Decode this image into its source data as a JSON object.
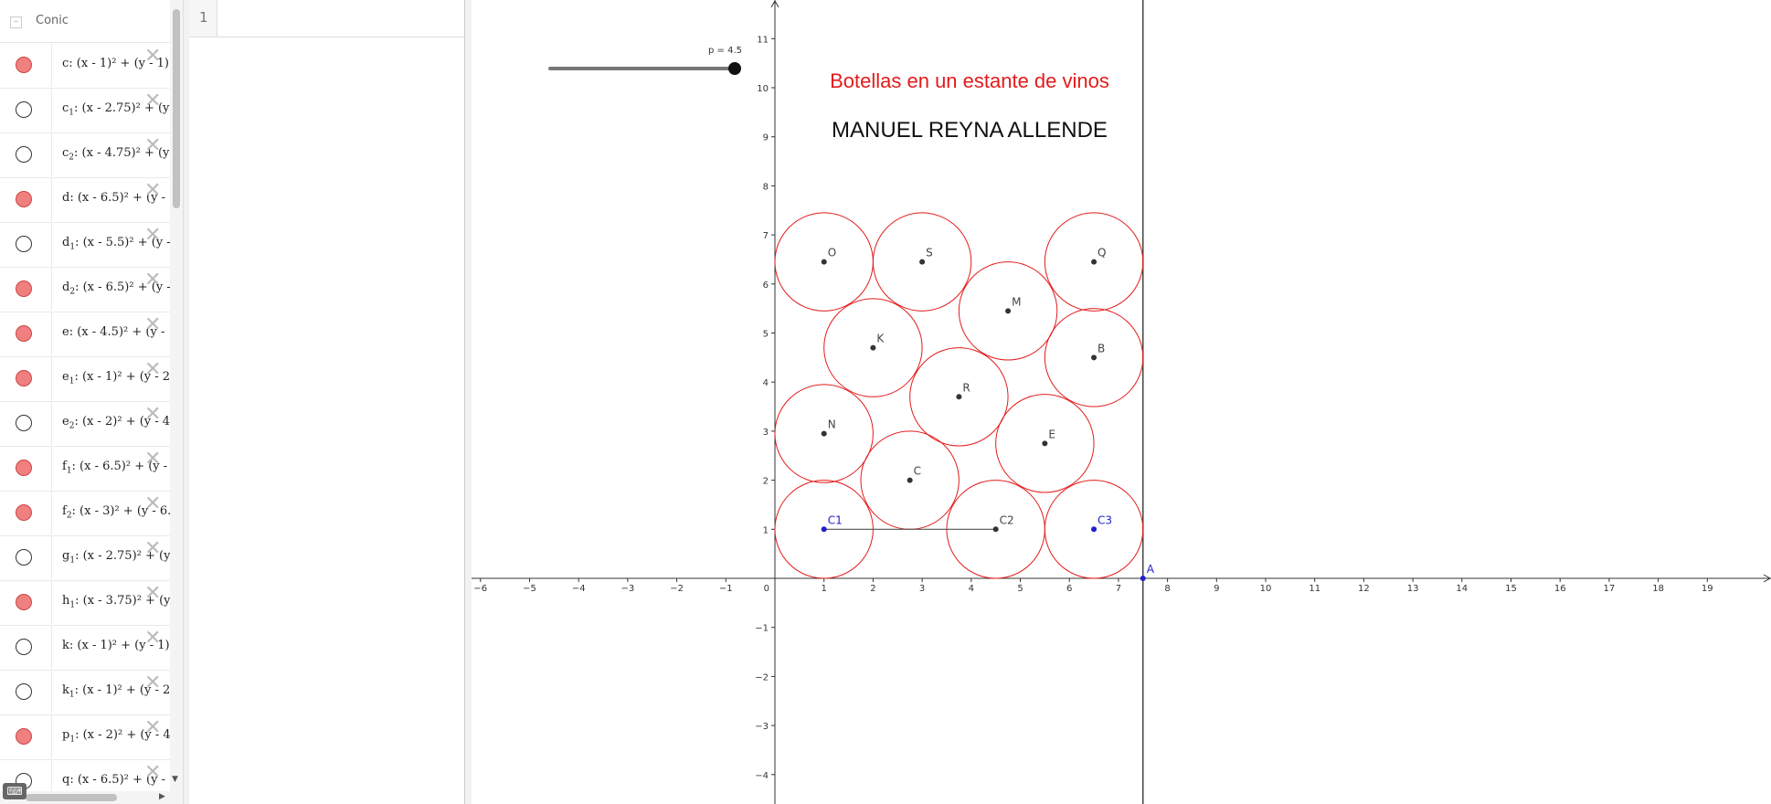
{
  "algebra": {
    "header": "Conic",
    "items": [
      {
        "name": "c",
        "sub": "",
        "expr": ": (x - 1)² + (y - 1)",
        "on": true
      },
      {
        "name": "c",
        "sub": "1",
        "expr": ": (x - 2.75)² + (y",
        "on": false
      },
      {
        "name": "c",
        "sub": "2",
        "expr": ": (x - 4.75)² + (y",
        "on": false
      },
      {
        "name": "d",
        "sub": "",
        "expr": ": (x - 6.5)² + (y -",
        "on": true
      },
      {
        "name": "d",
        "sub": "1",
        "expr": ": (x - 5.5)² + (y -",
        "on": false
      },
      {
        "name": "d",
        "sub": "2",
        "expr": ": (x - 6.5)² + (y -",
        "on": true
      },
      {
        "name": "e",
        "sub": "",
        "expr": ": (x - 4.5)² + (y - 1",
        "on": true
      },
      {
        "name": "e",
        "sub": "1",
        "expr": ": (x - 1)² + (y - 2",
        "on": true
      },
      {
        "name": "e",
        "sub": "2",
        "expr": ": (x - 2)² + (y - 4",
        "on": false
      },
      {
        "name": "f",
        "sub": "1",
        "expr": ": (x - 6.5)² + (y -",
        "on": true
      },
      {
        "name": "f",
        "sub": "2",
        "expr": ": (x - 3)² + (y - 6.",
        "on": true
      },
      {
        "name": "g",
        "sub": "1",
        "expr": ": (x - 2.75)² + (y",
        "on": false
      },
      {
        "name": "h",
        "sub": "1",
        "expr": ": (x - 3.75)² + (y",
        "on": true
      },
      {
        "name": "k",
        "sub": "",
        "expr": ": (x - 1)² + (y - 1)",
        "on": false
      },
      {
        "name": "k",
        "sub": "1",
        "expr": ": (x - 1)² + (y - 2",
        "on": false
      },
      {
        "name": "p",
        "sub": "1",
        "expr": ": (x - 2)² + (y - 4",
        "on": true
      },
      {
        "name": "q",
        "sub": "",
        "expr": ": (x - 6.5)² + (y -",
        "on": false
      }
    ]
  },
  "spreadsheet": {
    "row1": "1"
  },
  "graphics": {
    "title": "Botellas en un estante de vinos",
    "author": "MANUEL REYNA ALLENDE",
    "slider": {
      "label": "p = 4.5",
      "value": 4.5,
      "min": 0,
      "max": 4.5
    },
    "xticks": [
      -6,
      -5,
      -4,
      -3,
      -2,
      -1,
      1,
      2,
      3,
      4,
      5,
      6,
      7,
      8,
      9,
      10,
      11,
      12,
      13,
      14,
      15,
      16,
      17,
      18,
      19
    ],
    "yticks": [
      -4,
      -3,
      -2,
      -1,
      1,
      2,
      3,
      4,
      5,
      6,
      7,
      8,
      9,
      10,
      11
    ],
    "origin_label": "0",
    "wall_x": 7.5,
    "circles": [
      {
        "label": "C1",
        "x": 1,
        "y": 1,
        "blue": true
      },
      {
        "label": "C2",
        "x": 4.5,
        "y": 1,
        "blue": false
      },
      {
        "label": "C3",
        "x": 6.5,
        "y": 1,
        "blue": true
      },
      {
        "label": "C",
        "x": 2.75,
        "y": 2,
        "blue": false
      },
      {
        "label": "E",
        "x": 5.5,
        "y": 2.75,
        "blue": false
      },
      {
        "label": "N",
        "x": 1,
        "y": 2.95,
        "blue": false
      },
      {
        "label": "R",
        "x": 3.75,
        "y": 3.7,
        "blue": false
      },
      {
        "label": "K",
        "x": 2,
        "y": 4.7,
        "blue": false
      },
      {
        "label": "B",
        "x": 6.5,
        "y": 4.5,
        "blue": false
      },
      {
        "label": "M",
        "x": 4.75,
        "y": 5.45,
        "blue": false
      },
      {
        "label": "O",
        "x": 1,
        "y": 6.45,
        "blue": false
      },
      {
        "label": "S",
        "x": 3,
        "y": 6.45,
        "blue": false
      },
      {
        "label": "Q",
        "x": 6.5,
        "y": 6.45,
        "blue": false
      }
    ],
    "radius": 1,
    "segment": {
      "from": [
        1,
        1
      ],
      "to": [
        4.5,
        1
      ]
    },
    "point_A": {
      "label": "A",
      "x": 7.5,
      "y": 0
    }
  }
}
